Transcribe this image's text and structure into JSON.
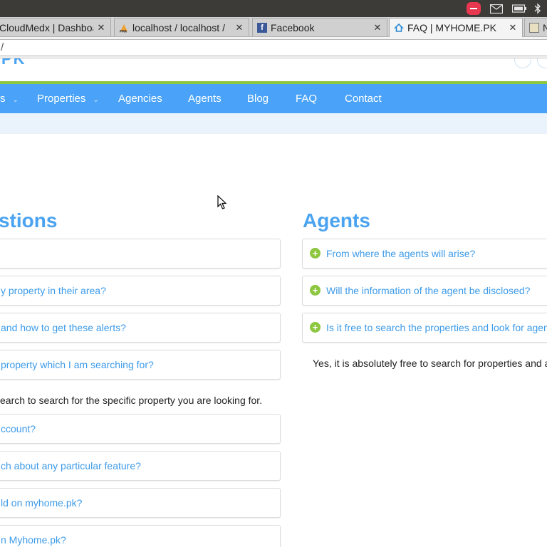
{
  "browser": {
    "tabs": [
      {
        "title": "CloudMedx | Dashboa",
        "favicon": "cloud-icon"
      },
      {
        "title": "localhost / localhost /",
        "favicon": "phpmyadmin-icon"
      },
      {
        "title": "Facebook",
        "favicon": "facebook-icon"
      },
      {
        "title": "FAQ | MYHOME.PK",
        "favicon": "home-icon",
        "active": true
      },
      {
        "title": "N",
        "favicon": "page-icon"
      }
    ],
    "close_glyph": "✕",
    "address": "/"
  },
  "nav": {
    "items": [
      {
        "label": "s",
        "has_dropdown": true
      },
      {
        "label": "Properties",
        "has_dropdown": true
      },
      {
        "label": "Agencies"
      },
      {
        "label": "Agents"
      },
      {
        "label": "Blog"
      },
      {
        "label": "FAQ"
      },
      {
        "label": "Contact"
      }
    ],
    "caret_glyph": "⌄",
    "color": "#4aa3f8"
  },
  "left_column": {
    "title": "stions",
    "questions": [
      {
        "text": ""
      },
      {
        "text": "y property in their area?"
      },
      {
        "text": "and how to get these alerts?"
      },
      {
        "text": "property which I am searching for?"
      }
    ],
    "answer": "earch to search for the specific property you are looking for.",
    "questions_after": [
      {
        "text": "ccount?"
      },
      {
        "text": "ch about any particular feature?"
      },
      {
        "text": "ld on myhome.pk?"
      },
      {
        "text": "n Myhome.pk?"
      }
    ]
  },
  "right_column": {
    "title": "Agents",
    "questions": [
      {
        "text": "From where the agents will arise?"
      },
      {
        "text": "Will the information of the agent be disclosed?"
      },
      {
        "text": "Is it free to search the properties and look for agen"
      }
    ],
    "answer": "Yes, it is absolutely free to search for properties and a"
  },
  "plus_glyph": "+",
  "colors": {
    "accent": "#4aa3f0",
    "green": "#8dc63f"
  }
}
